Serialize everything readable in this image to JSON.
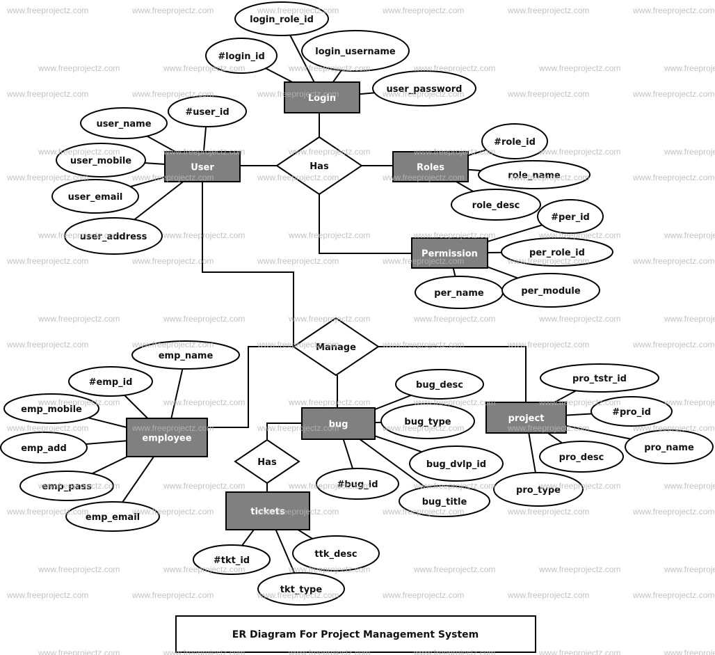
{
  "diagram": {
    "title": "ER Diagram For Project Management System",
    "watermark": "www.freeprojectz.com",
    "colors": {
      "entity_fill": "#808080",
      "stroke": "#000000",
      "entity_text": "#ffffff",
      "watermark": "#b8b8b8"
    },
    "entities": [
      {
        "id": "login",
        "label": "Login"
      },
      {
        "id": "user",
        "label": "User"
      },
      {
        "id": "roles",
        "label": "Roles"
      },
      {
        "id": "permission",
        "label": "Permission"
      },
      {
        "id": "employee",
        "label": "employee"
      },
      {
        "id": "bug",
        "label": "bug"
      },
      {
        "id": "project",
        "label": "project"
      },
      {
        "id": "tickets",
        "label": "tickets"
      }
    ],
    "relationships": [
      {
        "id": "has1",
        "label": "Has",
        "connects": [
          "login",
          "user",
          "roles",
          "permission"
        ]
      },
      {
        "id": "manage",
        "label": "Manage",
        "connects": [
          "user",
          "employee",
          "bug",
          "project"
        ]
      },
      {
        "id": "has2",
        "label": "Has",
        "connects": [
          "bug",
          "tickets"
        ]
      }
    ],
    "attributes": [
      {
        "id": "login_role_id",
        "label": "login_role_id",
        "entity": "login"
      },
      {
        "id": "login_id",
        "label": "#login_id",
        "entity": "login",
        "key": true
      },
      {
        "id": "login_username",
        "label": "login_username",
        "entity": "login"
      },
      {
        "id": "user_password",
        "label": "user_password",
        "entity": "login"
      },
      {
        "id": "user_id",
        "label": "#user_id",
        "entity": "user",
        "key": true
      },
      {
        "id": "user_name",
        "label": "user_name",
        "entity": "user"
      },
      {
        "id": "user_mobile",
        "label": "user_mobile",
        "entity": "user"
      },
      {
        "id": "user_email",
        "label": "user_email",
        "entity": "user"
      },
      {
        "id": "user_address",
        "label": "user_address",
        "entity": "user"
      },
      {
        "id": "role_id",
        "label": "#role_id",
        "entity": "roles",
        "key": true
      },
      {
        "id": "role_name",
        "label": "role_name",
        "entity": "roles"
      },
      {
        "id": "role_desc",
        "label": "role_desc",
        "entity": "roles"
      },
      {
        "id": "per_id",
        "label": "#per_id",
        "entity": "permission",
        "key": true
      },
      {
        "id": "per_role_id",
        "label": "per_role_id",
        "entity": "permission"
      },
      {
        "id": "per_name",
        "label": "per_name",
        "entity": "permission"
      },
      {
        "id": "per_module",
        "label": "per_module",
        "entity": "permission"
      },
      {
        "id": "emp_name",
        "label": "emp_name",
        "entity": "employee"
      },
      {
        "id": "emp_id",
        "label": "#emp_id",
        "entity": "employee",
        "key": true
      },
      {
        "id": "emp_mobile",
        "label": "emp_mobile",
        "entity": "employee"
      },
      {
        "id": "emp_add",
        "label": "emp_add",
        "entity": "employee"
      },
      {
        "id": "emp_pass",
        "label": "emp_pass",
        "entity": "employee"
      },
      {
        "id": "emp_email",
        "label": "emp_email",
        "entity": "employee"
      },
      {
        "id": "bug_desc",
        "label": "bug_desc",
        "entity": "bug"
      },
      {
        "id": "bug_type",
        "label": "bug_type",
        "entity": "bug"
      },
      {
        "id": "bug_dvlp_id",
        "label": "bug_dvlp_id",
        "entity": "bug"
      },
      {
        "id": "bug_id",
        "label": "#bug_id",
        "entity": "bug",
        "key": true
      },
      {
        "id": "bug_title",
        "label": "bug_title",
        "entity": "bug"
      },
      {
        "id": "pro_tstr_id",
        "label": "pro_tstr_id",
        "entity": "project"
      },
      {
        "id": "pro_id",
        "label": "#pro_id",
        "entity": "project",
        "key": true
      },
      {
        "id": "pro_name",
        "label": "pro_name",
        "entity": "project"
      },
      {
        "id": "pro_desc",
        "label": "pro_desc",
        "entity": "project"
      },
      {
        "id": "pro_type",
        "label": "pro_type",
        "entity": "project"
      },
      {
        "id": "tkt_id",
        "label": "#tkt_id",
        "entity": "tickets",
        "key": true
      },
      {
        "id": "ttk_desc",
        "label": "ttk_desc",
        "entity": "tickets"
      },
      {
        "id": "tkt_type",
        "label": "tkt_type",
        "entity": "tickets"
      }
    ]
  }
}
